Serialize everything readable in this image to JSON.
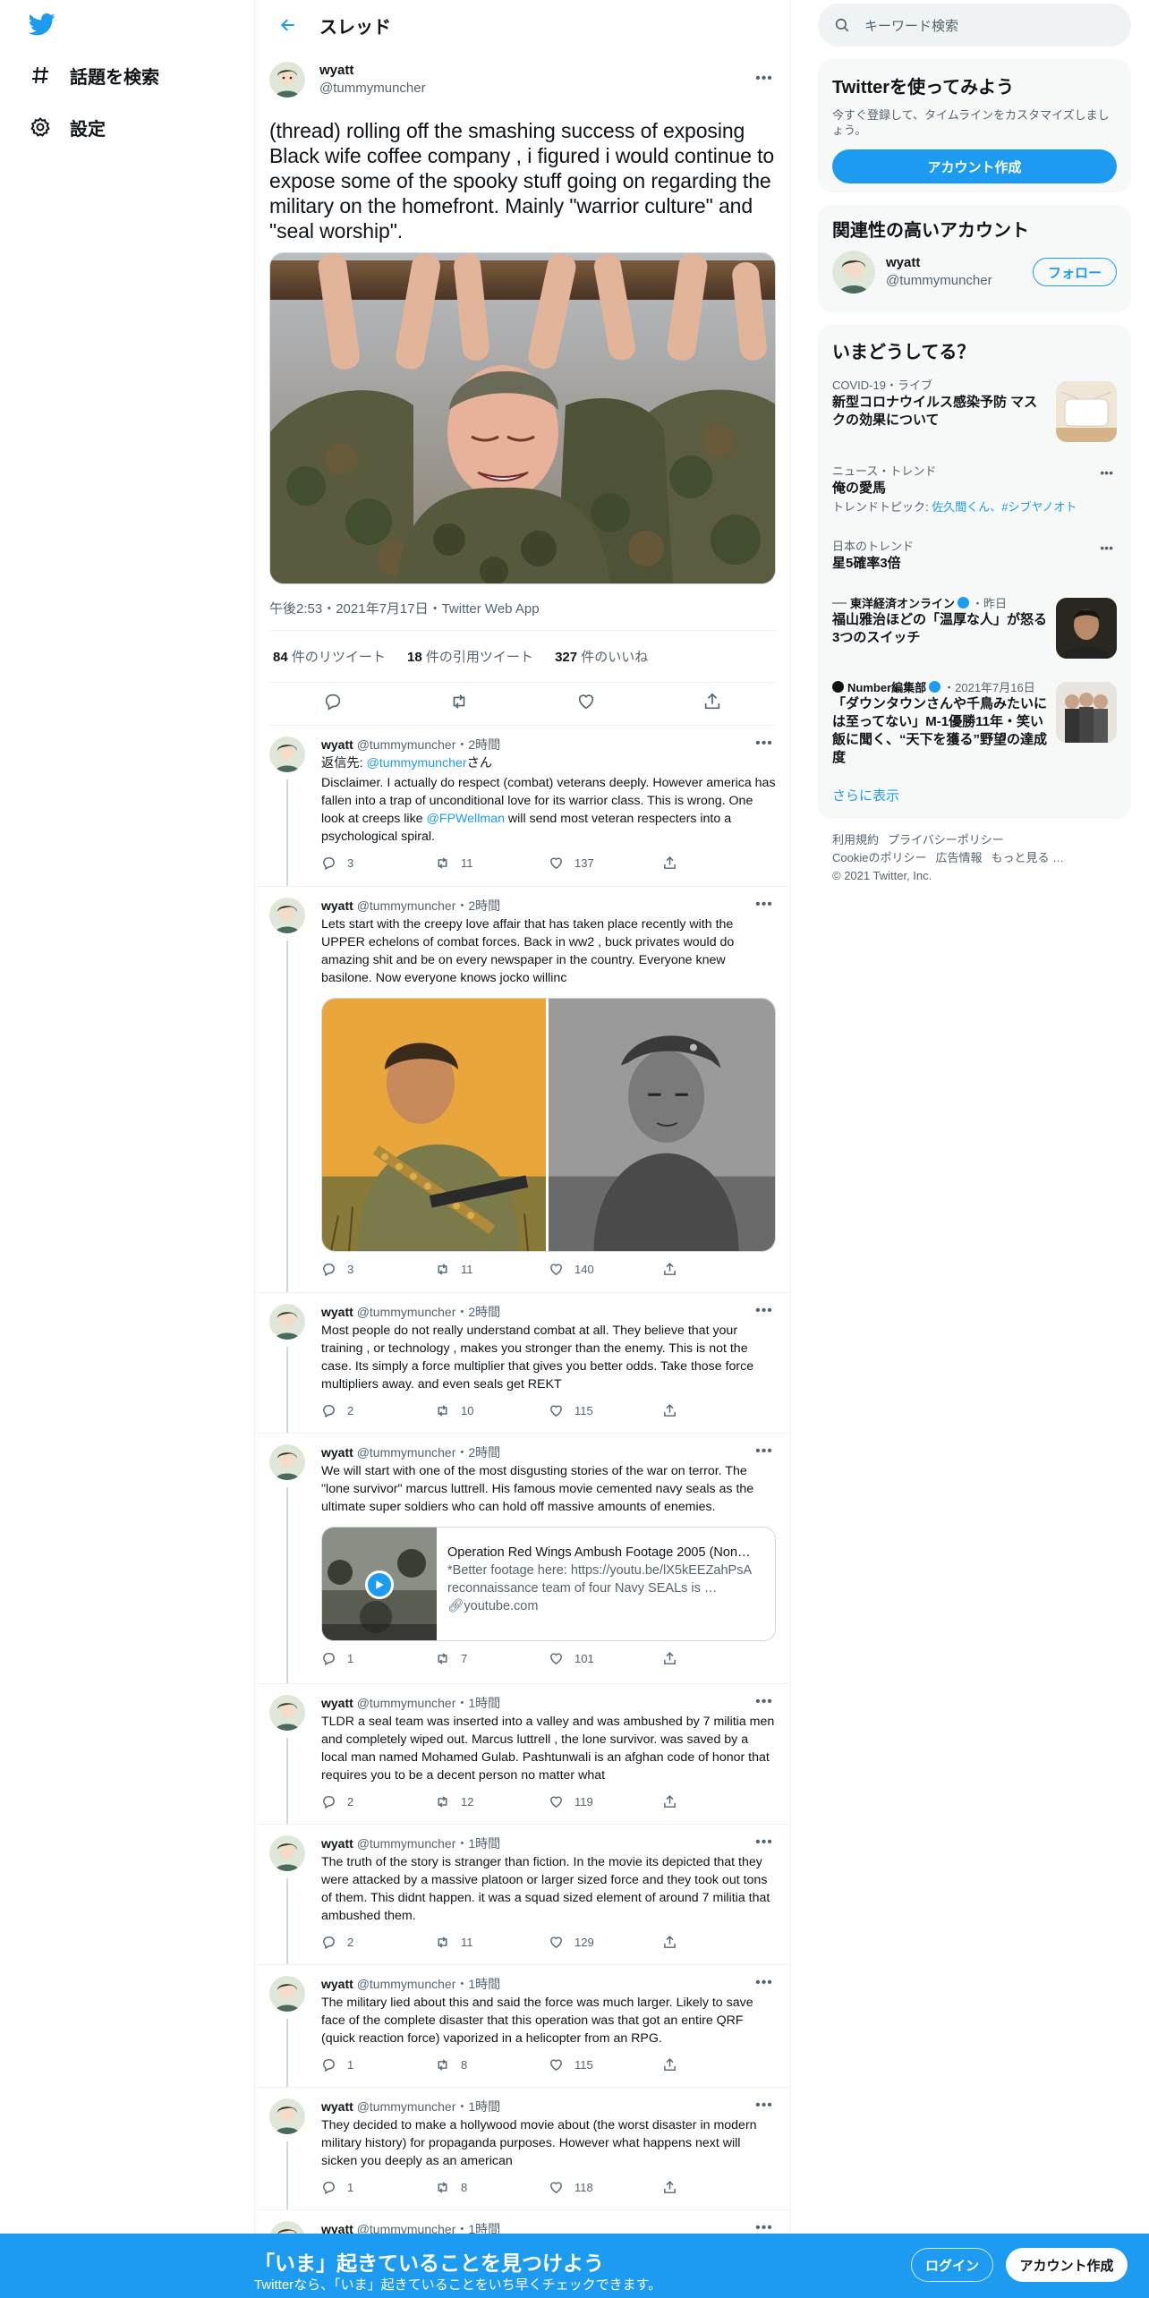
{
  "nav": {
    "explore_label": "話題を検索",
    "settings_label": "設定"
  },
  "header": {
    "title": "スレッド"
  },
  "focus_tweet": {
    "display_name": "wyatt",
    "username": "@tummymuncher",
    "text": "(thread) rolling off the smashing success of exposing Black wife coffee company , i figured i would continue to expose some of the spooky stuff going on regarding the military on the homefront. Mainly \"warrior culture\" and \"seal worship\".",
    "meta": "午後2:53・2021年7月17日・Twitter Web App",
    "retweets": "84",
    "retweets_label": " 件のリツイート",
    "quotes": "18",
    "quotes_label": " 件の引用ツイート",
    "likes": "327",
    "likes_label": " 件のいいね"
  },
  "replies": [
    {
      "name": "wyatt",
      "handle": "@tummymuncher",
      "time": "・2時間",
      "reply_to_prefix": "返信先: ",
      "reply_to_handle": "@tummymuncher",
      "reply_to_suffix": "さん",
      "text_before": "Disclaimer. I actually do respect (combat) veterans deeply. However america has fallen into a trap of unconditional love for its warrior class. This is wrong. One look at creeps like ",
      "mention": "@FPWellman",
      "text_after": " will send most veteran respecters into a psychological spiral.",
      "replies": "3",
      "retweets": "11",
      "likes": "137"
    },
    {
      "name": "wyatt",
      "handle": "@tummymuncher",
      "time": "・2時間",
      "text": "Lets start with the creepy love affair that has taken place recently with the UPPER echelons of combat forces. Back in ww2 , buck privates would do amazing shit and be on every newspaper in the country. Everyone knew basilone. Now everyone knows jocko willinc",
      "replies": "3",
      "retweets": "11",
      "likes": "140"
    },
    {
      "name": "wyatt",
      "handle": "@tummymuncher",
      "time": "・2時間",
      "text": "Most people do not really understand combat at all. They believe that your training , or technology , makes you stronger than the enemy. This is not the case. Its simply a force multiplier that gives you better odds. Take those force multipliers away. and even seals get REKT",
      "replies": "2",
      "retweets": "10",
      "likes": "115"
    },
    {
      "name": "wyatt",
      "handle": "@tummymuncher",
      "time": "・2時間",
      "text": "We will start with one of the most disgusting stories of the war on terror. The \"lone survivor\" marcus luttrell. His famous movie cemented navy seals as the ultimate super soldiers who can hold off massive amounts of enemies.",
      "card_title": "Operation Red Wings Ambush Footage 2005 (Non…",
      "card_desc": "*Better footage here: https://youtu.be/lX5kEEZahPsA reconnaissance team of four Navy SEALs is …",
      "card_domain": "youtube.com",
      "replies": "1",
      "retweets": "7",
      "likes": "101"
    },
    {
      "name": "wyatt",
      "handle": "@tummymuncher",
      "time": "・1時間",
      "text": "TLDR a seal team was inserted into a valley and was ambushed by 7 militia men and completely wiped out. Marcus luttrell , the lone survivor. was saved by a local man named Mohamed Gulab. Pashtunwali is an afghan code of honor that requires you to be a decent person no matter what",
      "replies": "2",
      "retweets": "12",
      "likes": "119"
    },
    {
      "name": "wyatt",
      "handle": "@tummymuncher",
      "time": "・1時間",
      "text": "The truth of the story is stranger than fiction. In the movie its depicted that they were attacked by a massive platoon or larger sized force and they took out tons of them. This didnt happen. it was a squad sized element of around 7 militia that ambushed them.",
      "replies": "2",
      "retweets": "11",
      "likes": "129"
    },
    {
      "name": "wyatt",
      "handle": "@tummymuncher",
      "time": "・1時間",
      "text": "The military lied about this and said the force was much larger. Likely to save face of the complete disaster that this operation was that got an entire QRF (quick reaction force) vaporized in a helicopter from an RPG.",
      "replies": "1",
      "retweets": "8",
      "likes": "115"
    },
    {
      "name": "wyatt",
      "handle": "@tummymuncher",
      "time": "・1時間",
      "text": "They decided to make a hollywood movie about (the worst disaster in modern military history) for propaganda purposes. However what happens next will sicken you deeply as an american",
      "replies": "1",
      "retweets": "8",
      "likes": "118"
    },
    {
      "name": "wyatt",
      "handle": "@tummymuncher",
      "time": "・1時間"
    }
  ],
  "right": {
    "search_placeholder": "キーワード検索",
    "signup_title": "Twitterを使ってみよう",
    "signup_text": "今すぐ登録して、タイムラインをカスタマイズしましょう。",
    "signup_button": "アカウント作成",
    "related_title": "関連性の高いアカウント",
    "related_name": "wyatt",
    "related_handle": "@tummymuncher",
    "follow_button": "フォロー",
    "trends_title": "いまどうしてる？",
    "trends": [
      {
        "context": "COVID-19・ライブ",
        "title": "新型コロナウイルス感染予防 マスクの効果について"
      },
      {
        "context": "ニュース・トレンド",
        "title": "俺の愛馬",
        "sub_prefix": "トレンドトピック: ",
        "sub_links": "佐久間くん、#シブヤノオト"
      },
      {
        "context": "日本のトレンド",
        "title": "星5確率3倍"
      },
      {
        "source": "東洋経済オンライン",
        "when": "・昨日",
        "title": "福山雅治ほどの「温厚な人」が怒る3つのスイッチ"
      },
      {
        "source": "Number編集部",
        "when": "・2021年7月16日",
        "title": "「ダウンタウンさんや千鳥みたいには至ってない」M-1優勝11年・笑い飯に聞く、“天下を獲る”野望の達成度"
      }
    ],
    "show_more": "さらに表示",
    "footer_line1_a": "利用規約",
    "footer_line1_b": "プライバシーポリシー",
    "footer_line2_a": "Cookieのポリシー",
    "footer_line2_b": "広告情報",
    "footer_line2_c": "もっと見る …",
    "copyright": "© 2021 Twitter, Inc."
  },
  "bottom": {
    "title": "「いま」起きていることを見つけよう",
    "subtitle": "Twitterなら、「いま」起きていることをいち早くチェックできます。",
    "login": "ログイン",
    "signup": "アカウント作成"
  },
  "colors": {
    "accent": "#1d9bf0",
    "text": "#0f1419",
    "muted": "#536471"
  }
}
